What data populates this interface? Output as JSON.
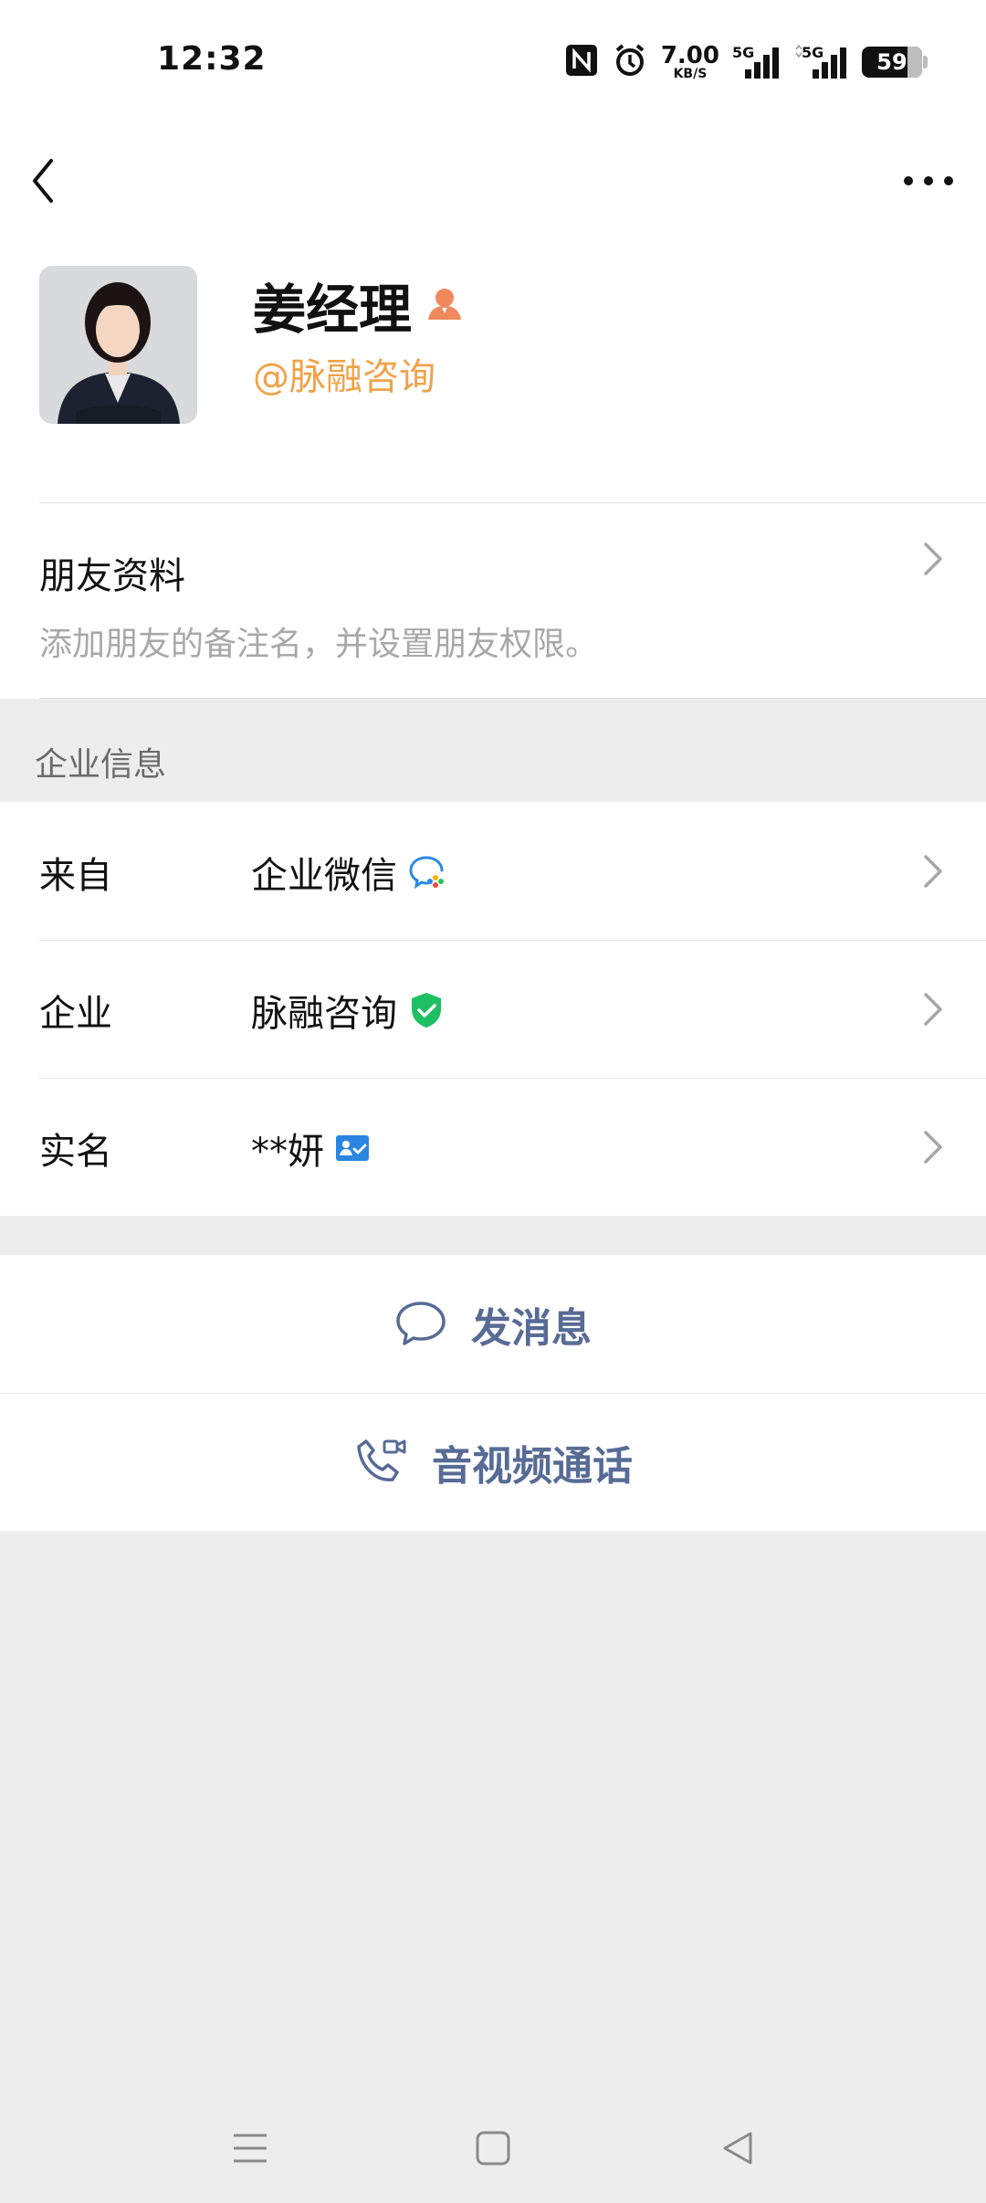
{
  "status_bar": {
    "time": "12:32",
    "net_speed_value": "7.00",
    "net_speed_unit": "KB/S",
    "signal_1_label": "5G",
    "signal_2_label": "5G",
    "battery": "59",
    "icons": [
      "nfc-icon",
      "alarm-icon",
      "signal-icon",
      "signal-icon",
      "battery-icon"
    ]
  },
  "nav": {
    "back_icon": "chevron-left-icon",
    "more_icon": "more-icon"
  },
  "profile": {
    "name": "姜经理",
    "company_tag": "@脉融咨询",
    "badge_color": "#f08a5d"
  },
  "friend": {
    "title": "朋友资料",
    "subtitle": "添加朋友的备注名，并设置朋友权限。"
  },
  "enterprise": {
    "section_label": "企业信息",
    "rows": [
      {
        "label": "来自",
        "value": "企业微信",
        "icon": "wecom-icon"
      },
      {
        "label": "企业",
        "value": "脉融咨询",
        "icon": "verified-shield-icon"
      },
      {
        "label": "实名",
        "value": "**妍",
        "icon": "id-card-icon"
      }
    ]
  },
  "actions": {
    "message": "发消息",
    "call": "音视频通话"
  },
  "colors": {
    "link_blue": "#576b95",
    "company_orange": "#f0a248",
    "verified_green": "#1fbf63",
    "idcard_blue": "#2a86e0"
  }
}
